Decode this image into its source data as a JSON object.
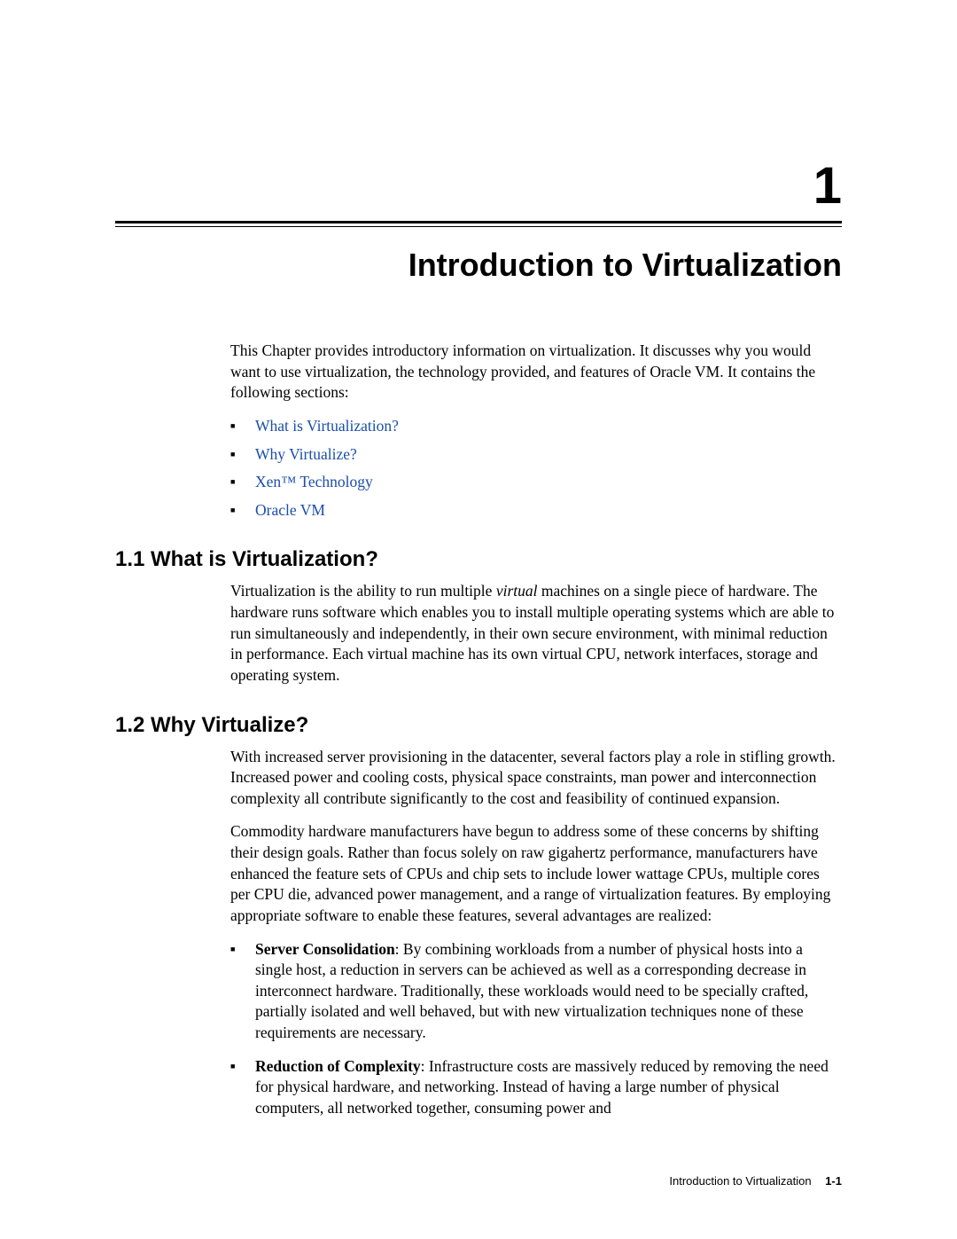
{
  "chapter": {
    "number": "1",
    "title": "Introduction to Virtualization"
  },
  "intro": "This Chapter provides introductory information on virtualization. It discusses why you would want to use virtualization, the technology provided, and features of Oracle VM. It contains the following sections:",
  "toc": [
    "What is Virtualization?",
    "Why Virtualize?",
    "Xen™ Technology",
    "Oracle VM"
  ],
  "section_1_1": {
    "heading": "1.1  What is Virtualization?",
    "body_pre": "Virtualization is the ability to run multiple ",
    "body_em": "virtual",
    "body_post": " machines on a single piece of hardware. The hardware runs software which enables you to install multiple operating systems which are able to run simultaneously and independently, in their own secure environment, with minimal reduction in performance. Each virtual machine has its own virtual CPU, network interfaces, storage and operating system."
  },
  "section_1_2": {
    "heading": "1.2  Why Virtualize?",
    "p1": "With increased server provisioning in the datacenter, several factors play a role in stifling growth. Increased power and cooling costs, physical space constraints, man power and interconnection complexity all contribute significantly to the cost and feasibility of continued expansion.",
    "p2": "Commodity hardware manufacturers have begun to address some of these concerns by shifting their design goals. Rather than focus solely on raw gigahertz performance, manufacturers have enhanced the feature sets of CPUs and chip sets to include lower wattage CPUs, multiple cores per CPU die, advanced power management, and a range of virtualization features. By employing appropriate software to enable these features, several advantages are realized:",
    "bullets": [
      {
        "term": "Server Consolidation",
        "text": ": By combining workloads from a number of physical hosts into a single host, a reduction in servers can be achieved as well as a corresponding decrease in interconnect hardware. Traditionally, these workloads would need to be specially crafted, partially isolated and well behaved, but with new virtualization techniques none of these requirements are necessary."
      },
      {
        "term": "Reduction of Complexity",
        "text": ": Infrastructure costs are massively reduced by removing the need for physical hardware, and networking. Instead of having a large number of physical computers, all networked together, consuming power and"
      }
    ]
  },
  "footer": {
    "title": "Introduction to Virtualization",
    "page": "1-1"
  }
}
